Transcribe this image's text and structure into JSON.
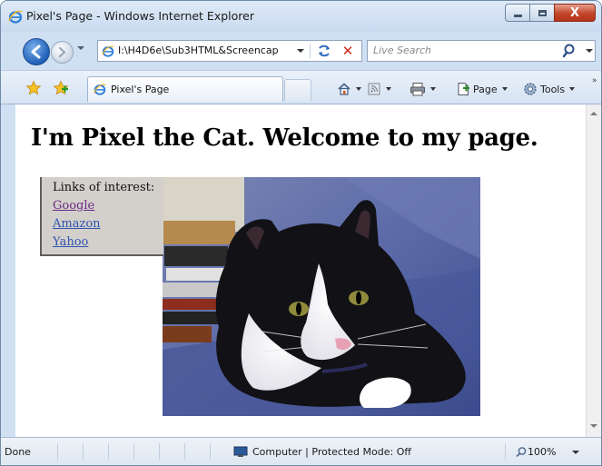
{
  "window": {
    "title": "Pixel's Page - Windows Internet Explorer",
    "controls": {
      "minimize": "minimize",
      "maximize": "maximize",
      "close": "X"
    }
  },
  "address_bar": {
    "url": "I:\\H4D6e\\Sub3HTML&Screencap",
    "refresh_icon": "refresh-icon",
    "stop_glyph": "✕"
  },
  "search": {
    "placeholder": "Live Search"
  },
  "tab": {
    "label": "Pixel's Page"
  },
  "command_bar": {
    "page_label": "Page",
    "tools_label": "Tools",
    "chevron": "»"
  },
  "page": {
    "heading": "I'm Pixel the Cat. Welcome to my page.",
    "links_heading": "Links of interest:",
    "links": [
      {
        "label": "Google",
        "visited": true
      },
      {
        "label": "Amazon",
        "visited": false
      },
      {
        "label": "Yahoo",
        "visited": false
      }
    ]
  },
  "status_bar": {
    "status": "Done",
    "zone": "Computer | Protected Mode: Off",
    "zoom": "100%"
  },
  "colors": {
    "link": "#2f53b0",
    "link_visited": "#6c2a86",
    "links_box_bg": "#d3d0cb",
    "chrome": "#cfe0f3"
  }
}
